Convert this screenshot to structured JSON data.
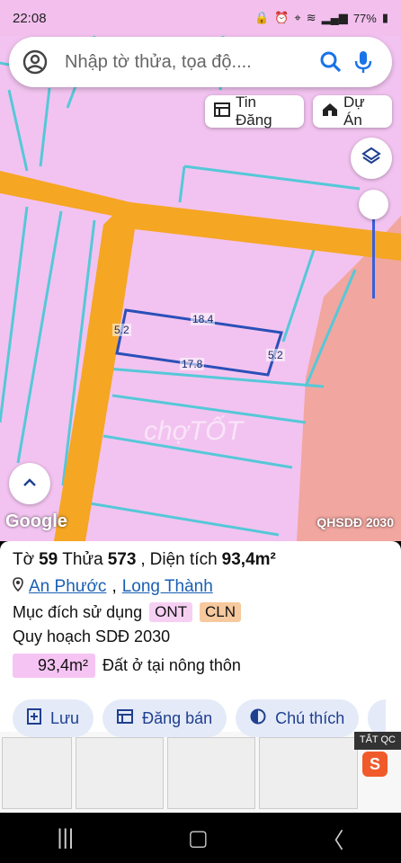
{
  "status_bar": {
    "time": "22:08",
    "battery": "77%"
  },
  "search": {
    "placeholder": "Nhập tờ thửa, tọa độ...."
  },
  "chips": {
    "tin_dang": "Tin Đăng",
    "du_an": "Dự Án"
  },
  "map": {
    "dimension_labels": {
      "top": "18.4",
      "bottom": "17.8",
      "left": "5.2",
      "right": "5.2"
    },
    "google_logo": "Google",
    "plan_tag": "QHSDĐ 2030",
    "watermark": "chợTỐT",
    "colors": {
      "residential": "#f2c3f0",
      "road": "#f5a623",
      "industrial": "#f2a6a0",
      "parcel_line": "#55c8d8",
      "selected_parcel": "#2b4fb8"
    }
  },
  "parcel": {
    "to_label": "Tờ",
    "to_number": "59",
    "thua_label": "Thửa",
    "thua_number": "573",
    "area_label": "Diện tích",
    "area_value": "93,4m²",
    "location": {
      "ward": "An Phước",
      "district": "Long Thành",
      "separator": ", "
    },
    "purpose_label": "Mục đích sử dụng",
    "purpose_codes": [
      "ONT",
      "CLN"
    ],
    "plan_label": "Quy hoạch SDĐ 2030",
    "plan_area": "93,4m²",
    "plan_desc": "Đất ở tại nông thôn"
  },
  "actions": {
    "save": "Lưu",
    "post": "Đăng bán",
    "legend": "Chú thích"
  },
  "ad": {
    "close_label": "TẮT QC",
    "shop_glyph": "S"
  }
}
